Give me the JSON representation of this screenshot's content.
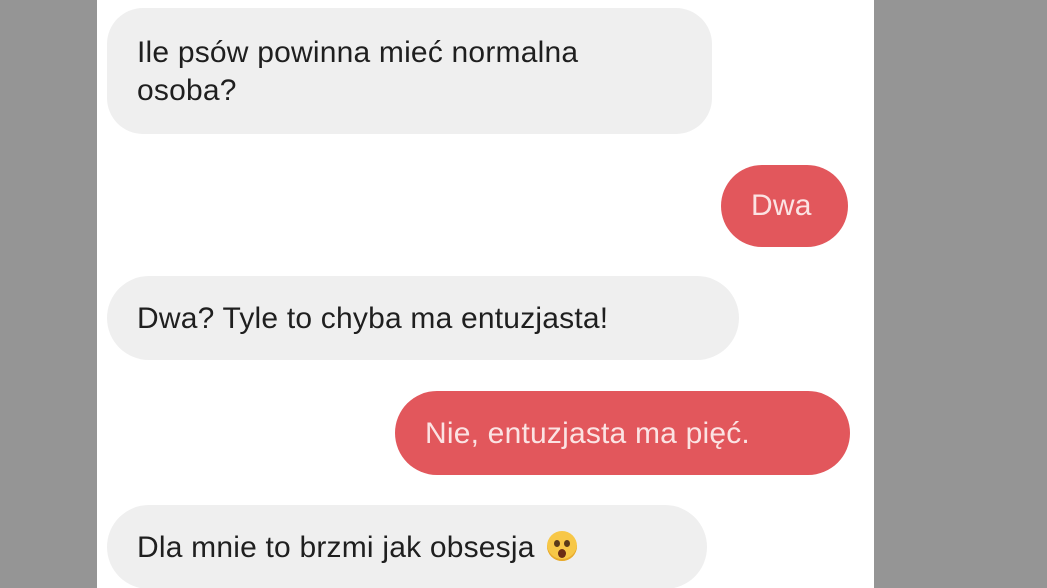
{
  "messages": [
    {
      "side": "incoming",
      "text": "Ile psów powinna mieć normalna osoba?"
    },
    {
      "side": "outgoing",
      "text": "Dwa"
    },
    {
      "side": "incoming",
      "text": "Dwa? Tyle to chyba ma entuzjasta!"
    },
    {
      "side": "outgoing",
      "text": "Nie, entuzjasta ma pięć."
    },
    {
      "side": "incoming",
      "text": "Dla mnie to brzmi jak obsesja",
      "emoji": "astonished-face-icon"
    }
  ],
  "colors": {
    "background": "#959595",
    "chat_background": "#ffffff",
    "incoming_bubble": "#efefef",
    "outgoing_bubble": "#e2575c",
    "outgoing_text": "#fbe3e3"
  }
}
